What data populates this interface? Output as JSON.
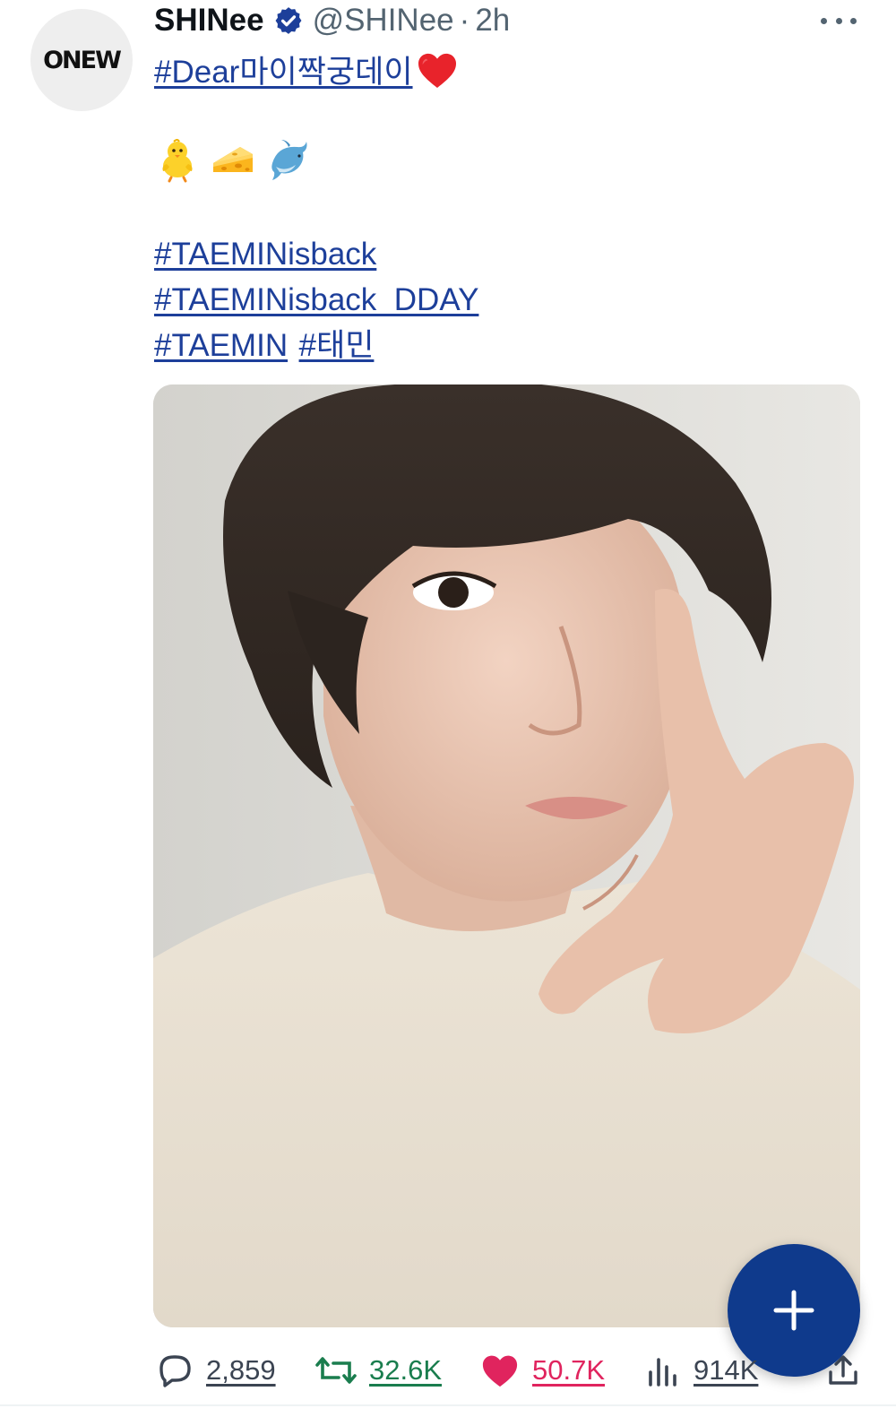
{
  "tweet": {
    "avatar_text": "ONEW",
    "display_name": "SHINee",
    "handle": "@SHINee",
    "separator": "·",
    "time": "2h",
    "text_line1_hashtag": "#Dear마이짝궁데이",
    "emojis": [
      "chick-emoji",
      "cheese-emoji",
      "dolphin-emoji"
    ],
    "hashtags": {
      "h1": "#TAEMINisback",
      "h2": "#TAEMINisback_DDAY",
      "h3": "#TAEMIN",
      "h4": "#태민"
    }
  },
  "actions": {
    "replies": "2,859",
    "reposts": "32.6K",
    "likes": "50.7K",
    "views": "914K"
  },
  "colors": {
    "link": "#1d3f9a",
    "repost": "#1a7d4e",
    "like": "#e0245e",
    "fab": "#0f3a8c",
    "muted": "#536471"
  }
}
